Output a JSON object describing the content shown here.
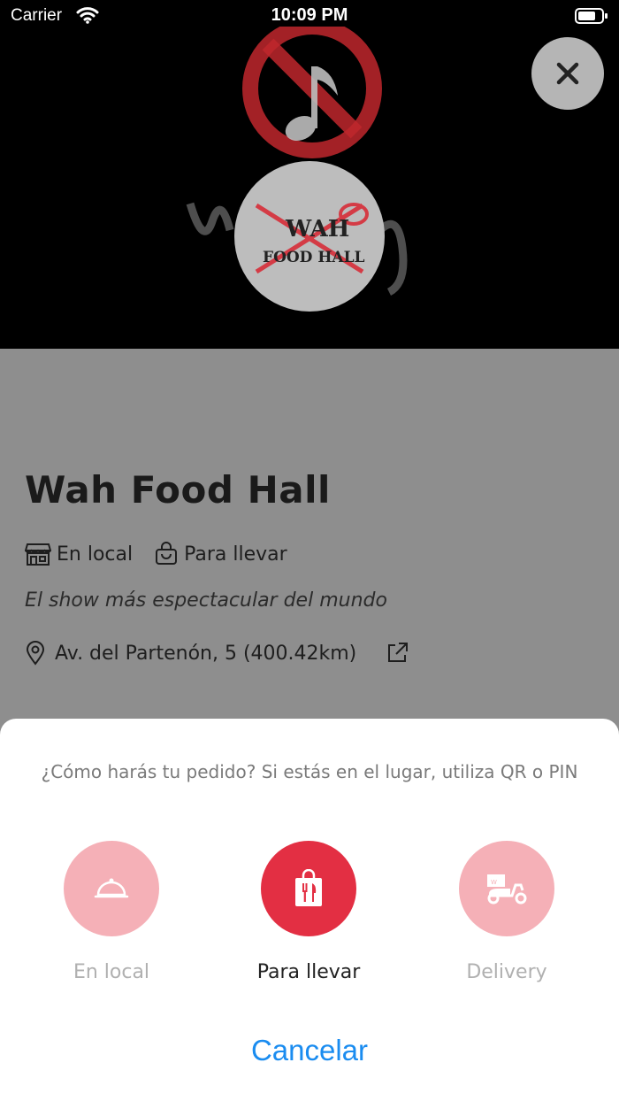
{
  "status_bar": {
    "carrier": "Carrier",
    "time": "10:09 PM"
  },
  "hero": {
    "logo_lines": [
      "WAH",
      "FOOD HALL"
    ]
  },
  "restaurant": {
    "name": "Wah Food Hall",
    "modes": [
      "En local",
      "Para llevar"
    ],
    "slogan": "El show más espectacular del mundo",
    "address": "Av. del Partenón, 5 (400.42km)"
  },
  "sheet": {
    "prompt": "¿Cómo harás tu pedido? Si estás en el lugar, utiliza QR o PIN",
    "options": [
      {
        "label": "En local",
        "icon": "cloche-icon",
        "selected": false
      },
      {
        "label": "Para llevar",
        "icon": "takeaway-bag-icon",
        "selected": true
      },
      {
        "label": "Delivery",
        "icon": "delivery-scooter-icon",
        "selected": false
      }
    ],
    "cancel_label": "Cancelar"
  },
  "colors": {
    "accent": "#e32f43",
    "accent_soft": "#f5b0b7",
    "link": "#1a8cf0"
  }
}
